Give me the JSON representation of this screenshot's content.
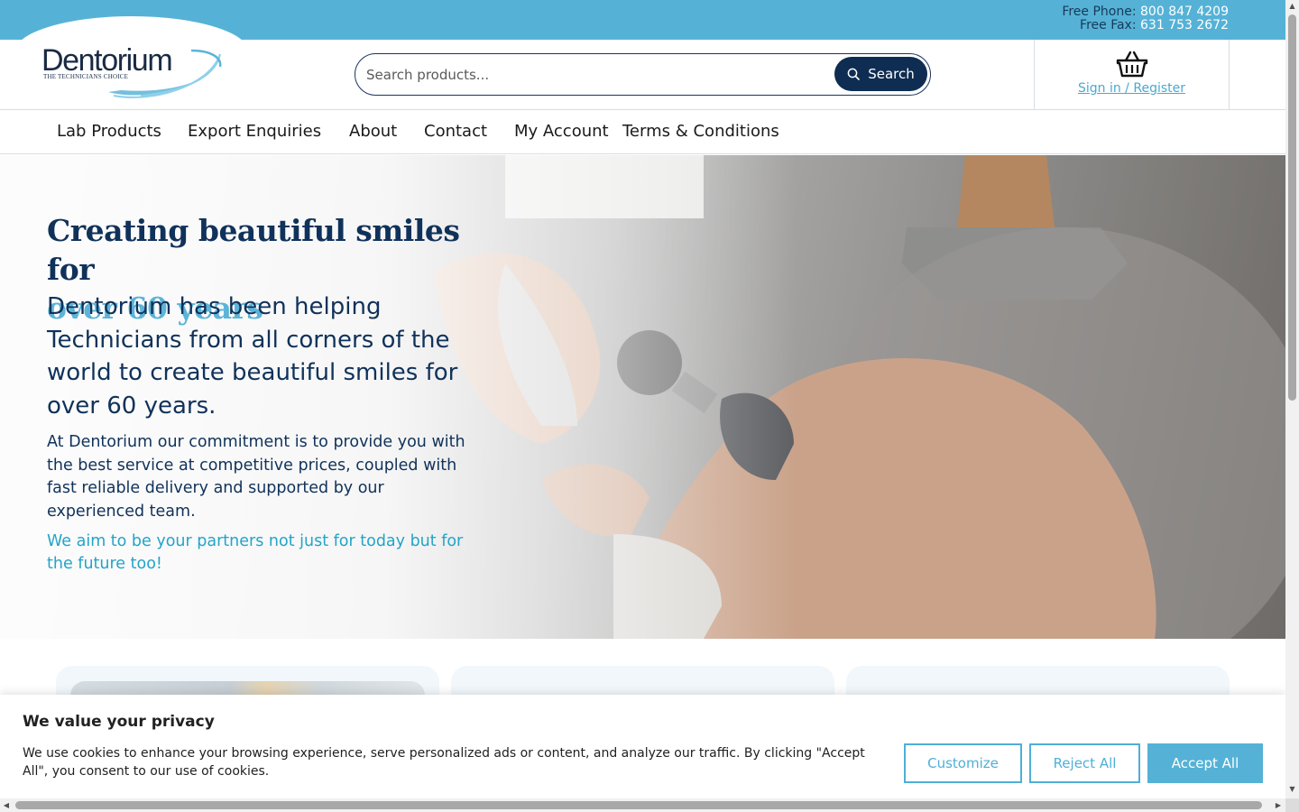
{
  "topbar": {
    "phone_label": "Free Phone:",
    "phone_value": "800 847 4209",
    "fax_label": "Free Fax:",
    "fax_value": "631 753 2672"
  },
  "logo": {
    "wordmark": "Dentorium",
    "tagline": "THE TECHNICIANS CHOICE",
    "icon": "swoosh-icon"
  },
  "search": {
    "placeholder": "Search products...",
    "button_label": "Search",
    "icon": "search-icon"
  },
  "account": {
    "icon": "basket-icon",
    "link_label": "Sign in / Register"
  },
  "nav": {
    "items": [
      {
        "label": "Lab Products"
      },
      {
        "label": "Export Enquiries"
      },
      {
        "label": "About"
      },
      {
        "label": "Contact"
      },
      {
        "label": "My Account"
      },
      {
        "label": "Terms & Conditions"
      }
    ]
  },
  "hero": {
    "heading_line1": "Creating beautiful smiles for",
    "heading_accent": "over 60 years",
    "lead": "Dentorium has been helping Technicians from all corners of the world to create beautiful smiles for over 60 years.",
    "body": "At Dentorium our commitment is to provide you with the best service at competitive prices, coupled with fast reliable delivery and supported by our experienced team.",
    "tagline": "We aim to be your partners not just for today but for the future too!"
  },
  "cookie": {
    "title": "We value your privacy",
    "text": "We use cookies to enhance your browsing experience, serve personalized ads or content, and analyze our traffic. By clicking \"Accept All\", you consent to our use of cookies.",
    "customize_label": "Customize",
    "reject_label": "Reject All",
    "accept_label": "Accept All"
  },
  "colors": {
    "brand_blue": "#55b2d6",
    "navy": "#10325a",
    "accent_teal": "#23a4c8"
  }
}
